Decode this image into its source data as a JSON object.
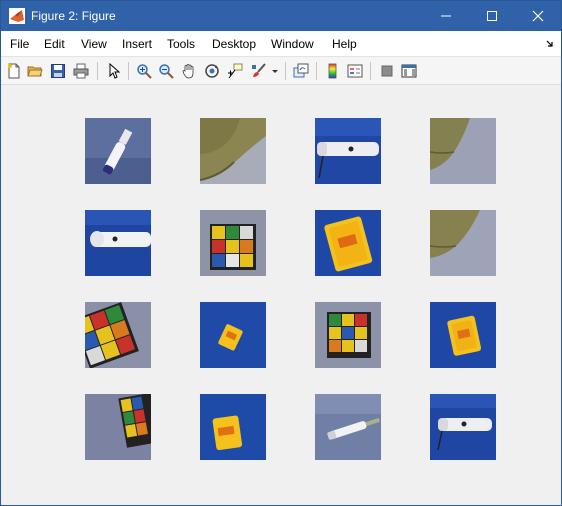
{
  "window": {
    "title": "Figure 2: Figure"
  },
  "menu": {
    "file": "File",
    "edit": "Edit",
    "view": "View",
    "insert": "Insert",
    "tools": "Tools",
    "desktop": "Desktop",
    "window": "Window",
    "help": "Help"
  },
  "toolbar": {
    "icons": [
      "new-figure-icon",
      "open-file-icon",
      "save-icon",
      "print-icon",
      "edit-plot-arrow-icon",
      "zoom-in-icon",
      "zoom-out-icon",
      "pan-hand-icon",
      "rotate-3d-icon",
      "data-cursor-icon",
      "brush-icon",
      "brush-dropdown-icon",
      "link-plot-icon",
      "colorbar-icon",
      "legend-icon",
      "hide-plot-tools-icon",
      "show-plot-tools-icon"
    ]
  },
  "figure": {
    "thumbnails": [
      {
        "subject": "white marker pen on blue cloth"
      },
      {
        "subject": "olive cap on grey background"
      },
      {
        "subject": "flashlight on blue cloth"
      },
      {
        "subject": "olive cap on grey background"
      },
      {
        "subject": "flashlight on blue cloth"
      },
      {
        "subject": "rubik cube on grey background"
      },
      {
        "subject": "yellow card deck on blue cloth"
      },
      {
        "subject": "olive cap on grey background"
      },
      {
        "subject": "rubik cube close-up"
      },
      {
        "subject": "yellow card deck small on blue cloth"
      },
      {
        "subject": "rubik cube on grey background"
      },
      {
        "subject": "yellow card deck on blue cloth"
      },
      {
        "subject": "rubik cube corner on grey background"
      },
      {
        "subject": "yellow card deck on blue cloth"
      },
      {
        "subject": "marker pen on grey-blue background"
      },
      {
        "subject": "flashlight on blue cloth"
      }
    ]
  }
}
